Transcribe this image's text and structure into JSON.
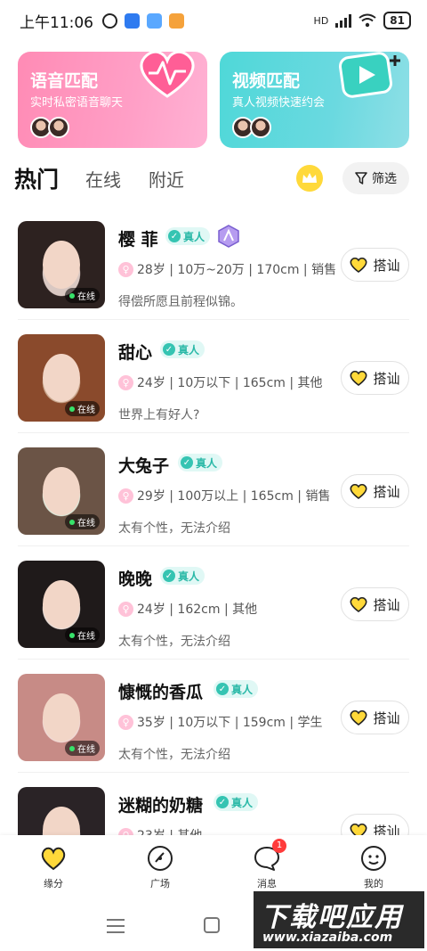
{
  "status_bar": {
    "time": "上午11:06",
    "network": "HD",
    "battery": "81"
  },
  "cards": {
    "voice": {
      "title": "语音匹配",
      "subtitle": "实时私密语音聊天"
    },
    "video": {
      "title": "视频匹配",
      "subtitle": "真人视频快速约会"
    }
  },
  "tabs": [
    "热门",
    "在线",
    "附近"
  ],
  "filter_label": "筛选",
  "real_label": "真人",
  "online_label": "在线",
  "chat_label": "搭讪",
  "users": [
    {
      "name": "樱 菲",
      "info": "28岁 | 10万~20万 | 170cm | 销售",
      "sign": "得偿所愿且前程似锦。",
      "online": true,
      "badge": true
    },
    {
      "name": "甜心",
      "info": "24岁 | 10万以下 | 165cm | 其他",
      "sign": "世界上有好人?",
      "online": true,
      "badge": false
    },
    {
      "name": "大兔子",
      "info": "29岁 | 100万以上 | 165cm | 销售",
      "sign": "太有个性，无法介绍",
      "online": true,
      "badge": false
    },
    {
      "name": "晚晚",
      "info": "24岁 | 162cm | 其他",
      "sign": "太有个性，无法介绍",
      "online": true,
      "badge": false
    },
    {
      "name": "慷慨的香瓜",
      "info": "35岁 | 10万以下 | 159cm | 学生",
      "sign": "太有个性，无法介绍",
      "online": true,
      "badge": false
    },
    {
      "name": "迷糊的奶糖",
      "info": "23岁 | 其他",
      "sign": "",
      "online": false,
      "badge": false
    }
  ],
  "nav": [
    {
      "label": "缘分",
      "icon": "heart-icon"
    },
    {
      "label": "广场",
      "icon": "compass-icon"
    },
    {
      "label": "消息",
      "icon": "message-icon",
      "badge": "1"
    },
    {
      "label": "我的",
      "icon": "profile-icon"
    }
  ],
  "watermark": {
    "title": "下载吧应用",
    "url": "www.xiazaiba.com"
  }
}
